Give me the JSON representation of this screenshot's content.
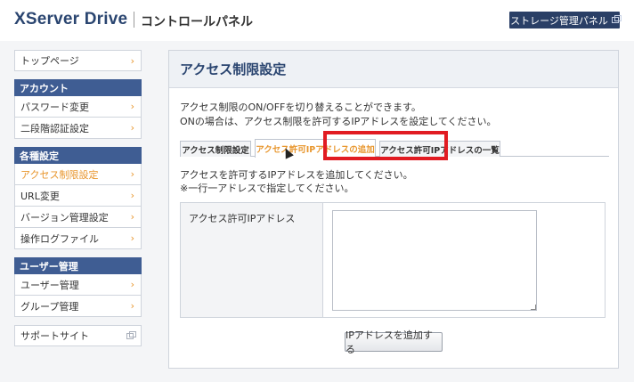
{
  "header": {
    "logo": "XServer Drive",
    "panel_title": "コントロールパネル",
    "storage_button": "ストレージ管理パネル"
  },
  "sidebar": {
    "top_page": "トップページ",
    "account_head": "アカウント",
    "account_items": [
      "パスワード変更",
      "二段階認証設定"
    ],
    "settings_head": "各種設定",
    "settings_items": [
      "アクセス制限設定",
      "URL変更",
      "バージョン管理設定",
      "操作ログファイル"
    ],
    "active_item": "アクセス制限設定",
    "users_head": "ユーザー管理",
    "users_items": [
      "ユーザー管理",
      "グループ管理"
    ],
    "support": "サポートサイト",
    "chevron": "›"
  },
  "content": {
    "title": "アクセス制限設定",
    "desc_line1": "アクセス制限のON/OFFを切り替えることができます。",
    "desc_line2": "ONの場合は、アクセス制限を許可するIPアドレスを設定してください。",
    "tabs": [
      "アクセス制限設定",
      "アクセス許可IPアドレスの追加",
      "アクセス許可IPアドレスの一覧"
    ],
    "active_tab": "アクセス許可IPアドレスの追加",
    "sub_desc_line1": "アクセスを許可するIPアドレスを追加してください。",
    "sub_desc_line2": "※一行一アドレスで指定してください。",
    "field_label": "アクセス許可IPアドレス",
    "field_value": "",
    "submit_button": "IPアドレスを追加する"
  },
  "colors": {
    "brand": "#2a4570",
    "sidebar_head": "#3f5d93",
    "accent": "#e8962d",
    "highlight": "#e11b22"
  }
}
